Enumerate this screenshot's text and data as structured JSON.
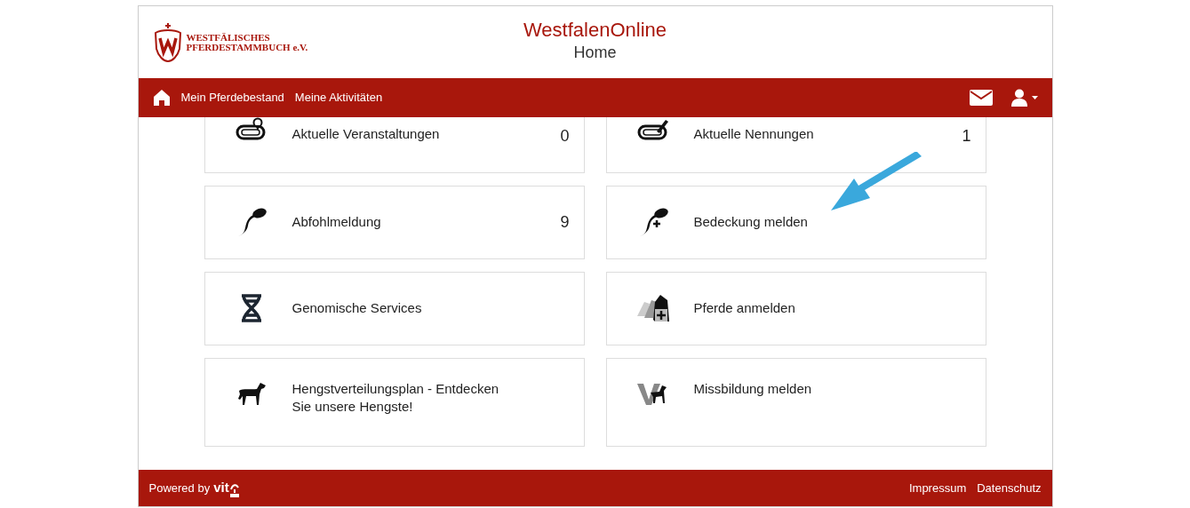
{
  "logo": {
    "line1": "WESTFÄLISCHES",
    "line2": "PFERDESTAMMBUCH e.V."
  },
  "header": {
    "title": "WestfalenOnline",
    "subtitle": "Home"
  },
  "nav": {
    "items": [
      "Mein Pferdebestand",
      "Meine Aktivitäten"
    ]
  },
  "tiles": [
    {
      "label": "Aktuelle Veranstaltungen",
      "count": "0"
    },
    {
      "label": "Aktuelle Nennungen",
      "count": "1"
    },
    {
      "label": "Abfohlmeldung",
      "count": "9"
    },
    {
      "label": "Bedeckung melden"
    },
    {
      "label": "Genomische Services"
    },
    {
      "label": "Pferde anmelden"
    },
    {
      "label": "Hengstverteilungsplan - Entdecken Sie unsere Hengste!"
    },
    {
      "label": "Missbildung melden"
    }
  ],
  "footer": {
    "powered_by": "Powered by",
    "brand": "vit",
    "links": [
      "Impressum",
      "Datenschutz"
    ]
  }
}
